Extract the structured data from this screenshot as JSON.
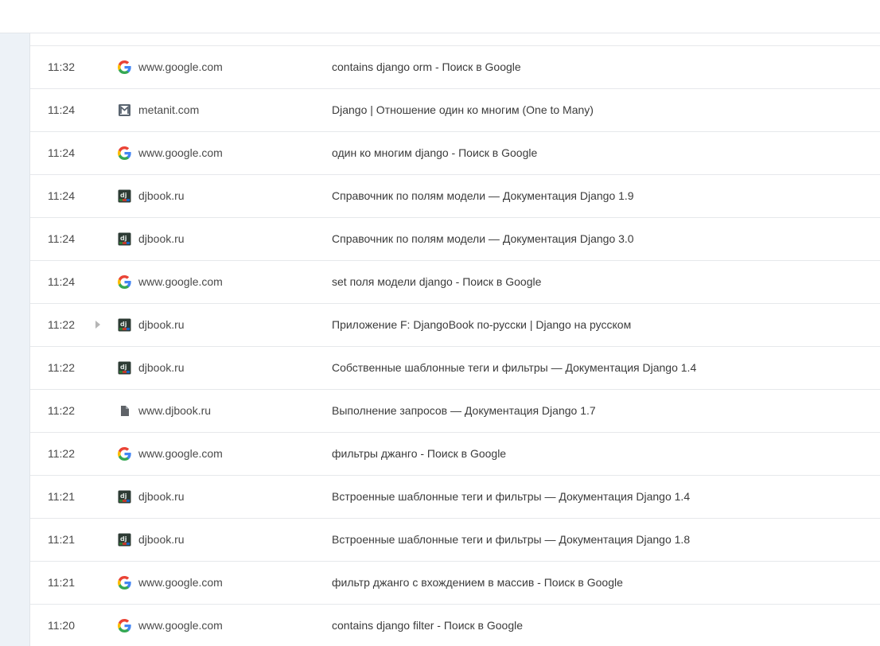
{
  "history": {
    "rows": [
      {
        "time": "11:32",
        "icon": "google-icon",
        "domain": "www.google.com",
        "title": "contains django orm - Поиск в Google"
      },
      {
        "time": "11:24",
        "icon": "metanit-icon",
        "domain": "metanit.com",
        "title": "Django | Отношение один ко многим (One to Many)"
      },
      {
        "time": "11:24",
        "icon": "google-icon",
        "domain": "www.google.com",
        "title": "один ко многим django - Поиск в Google"
      },
      {
        "time": "11:24",
        "icon": "djbook-icon",
        "domain": "djbook.ru",
        "title": "Справочник по полям модели — Документация Django 1.9"
      },
      {
        "time": "11:24",
        "icon": "djbook-icon",
        "domain": "djbook.ru",
        "title": "Справочник по полям модели — Документация Django 3.0"
      },
      {
        "time": "11:24",
        "icon": "google-icon",
        "domain": "www.google.com",
        "title": "set поля модели django - Поиск в Google"
      },
      {
        "time": "11:22",
        "icon": "djbook-icon",
        "domain": "djbook.ru",
        "title": "Приложение F: DjangoBook по-русски | Django на русском",
        "expandable": true
      },
      {
        "time": "11:22",
        "icon": "djbook-icon",
        "domain": "djbook.ru",
        "title": "Собственные шаблонные теги и фильтры — Документация Django 1.4"
      },
      {
        "time": "11:22",
        "icon": "file-icon",
        "domain": "www.djbook.ru",
        "title": "Выполнение запросов — Документация Django 1.7"
      },
      {
        "time": "11:22",
        "icon": "google-icon",
        "domain": "www.google.com",
        "title": "фильтры джанго - Поиск в Google"
      },
      {
        "time": "11:21",
        "icon": "djbook-icon",
        "domain": "djbook.ru",
        "title": "Встроенные шаблонные теги и фильтры — Документация Django 1.4"
      },
      {
        "time": "11:21",
        "icon": "djbook-icon",
        "domain": "djbook.ru",
        "title": "Встроенные шаблонные теги и фильтры — Документация Django 1.8"
      },
      {
        "time": "11:21",
        "icon": "google-icon",
        "domain": "www.google.com",
        "title": "фильтр джанго с вхождением в массив - Поиск в Google"
      },
      {
        "time": "11:20",
        "icon": "google-icon",
        "domain": "www.google.com",
        "title": "contains django filter - Поиск в Google"
      }
    ]
  },
  "colors": {
    "sidebar_bg": "#edf2f7",
    "row_border": "#e6e8eb",
    "text": "#3b3b3b"
  }
}
